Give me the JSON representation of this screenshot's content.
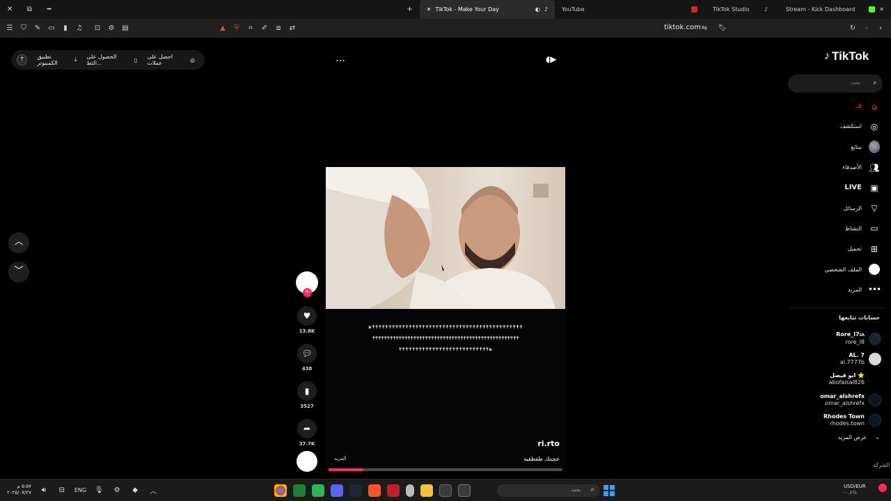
{
  "browser": {
    "tabs": [
      {
        "label": "TikTok - Make Your Day",
        "active": true
      },
      {
        "label": "YouTube",
        "active": false
      },
      {
        "label": "TikTok Studio",
        "active": false
      },
      {
        "label": "Stream - Kick Dashboard",
        "active": false
      }
    ],
    "url": "tiktok.com"
  },
  "page": {
    "promo": {
      "get_coins": "احصل على عملات",
      "get_app": "الحصول على التط...",
      "desktop_app": "تطبيق الكمبيوتر"
    },
    "more_icon": "…"
  },
  "video": {
    "caption_lines": [
      "ﻫ✝✝✝✝✝✝✝✝✝✝✝✝✝✝✝✝✝✝✝✝✝✝✝✝✝✝✝✝✝✝✝✝✝✝✝✝✝✝✝✝✝✝✝✝✝",
      "✝✝✝✝✝✝✝✝✝✝✝✝✝✝✝✝✝✝✝✝✝✝✝✝✝✝✝✝✝✝✝✝✝✝✝✝✝✝✝✝✝✝✝✝✝✝✝✝✝✝",
      "✝✝✝✝✝✝✝✝✝✝✝✝✝✝✝✝✝✝✝✝✝✝✝✝✝✝✝ﻫ"
    ],
    "author": "ri.rto",
    "description": "عجبتك طقطقية",
    "more_label": "المزيد",
    "progress": 0.15
  },
  "actions": {
    "likes": "13.8K",
    "comments": "438",
    "saves": "3527",
    "shares": "37.7K"
  },
  "sidebar": {
    "logo": "TikTok",
    "search_placeholder": "بحث",
    "nav": [
      {
        "label": "لك",
        "icon": "home-icon"
      },
      {
        "label": "استكشف",
        "icon": "compass-icon"
      },
      {
        "label": "متابَع",
        "icon": "avatar-icon"
      },
      {
        "label": "الأصدقاء",
        "icon": "friends-icon"
      },
      {
        "label": "LIVE",
        "icon": "live-icon"
      },
      {
        "label": "الرسائل",
        "icon": "send-icon"
      },
      {
        "label": "النشاط",
        "icon": "inbox-icon"
      },
      {
        "label": "تحميل",
        "icon": "upload-icon"
      },
      {
        "label": "الملف الشخصي",
        "icon": "profile-icon"
      },
      {
        "label": "المزيد",
        "icon": "more-icon"
      }
    ],
    "following_title": "حسابات تتابعها",
    "following": [
      {
        "display": "Rore_l7",
        "username": "rore_l8",
        "badge": "SA"
      },
      {
        "display": "AL. 7",
        "username": "al.7777b"
      },
      {
        "display": "ابو فيصل ⭐",
        "username": "abofaisal826"
      },
      {
        "display": "omar_alshrefx",
        "username": "omar_alshrefx"
      },
      {
        "display": "Rhodes Town",
        "username": "rhodes.town"
      }
    ],
    "show_more": "عرض المزيد",
    "cut_text": "الشركة"
  },
  "taskbar": {
    "time": "٥:٥٧ م",
    "date": "٢٠٢٥/٠٧/٢٧",
    "lang": "ENG",
    "search_placeholder": "بحث",
    "ticker": "USD/EUR",
    "ticker_change": "-٠.٨%"
  },
  "colors": {
    "accent": "#fe2c55",
    "background": "#000000",
    "sidebar_bg": "#000000"
  }
}
